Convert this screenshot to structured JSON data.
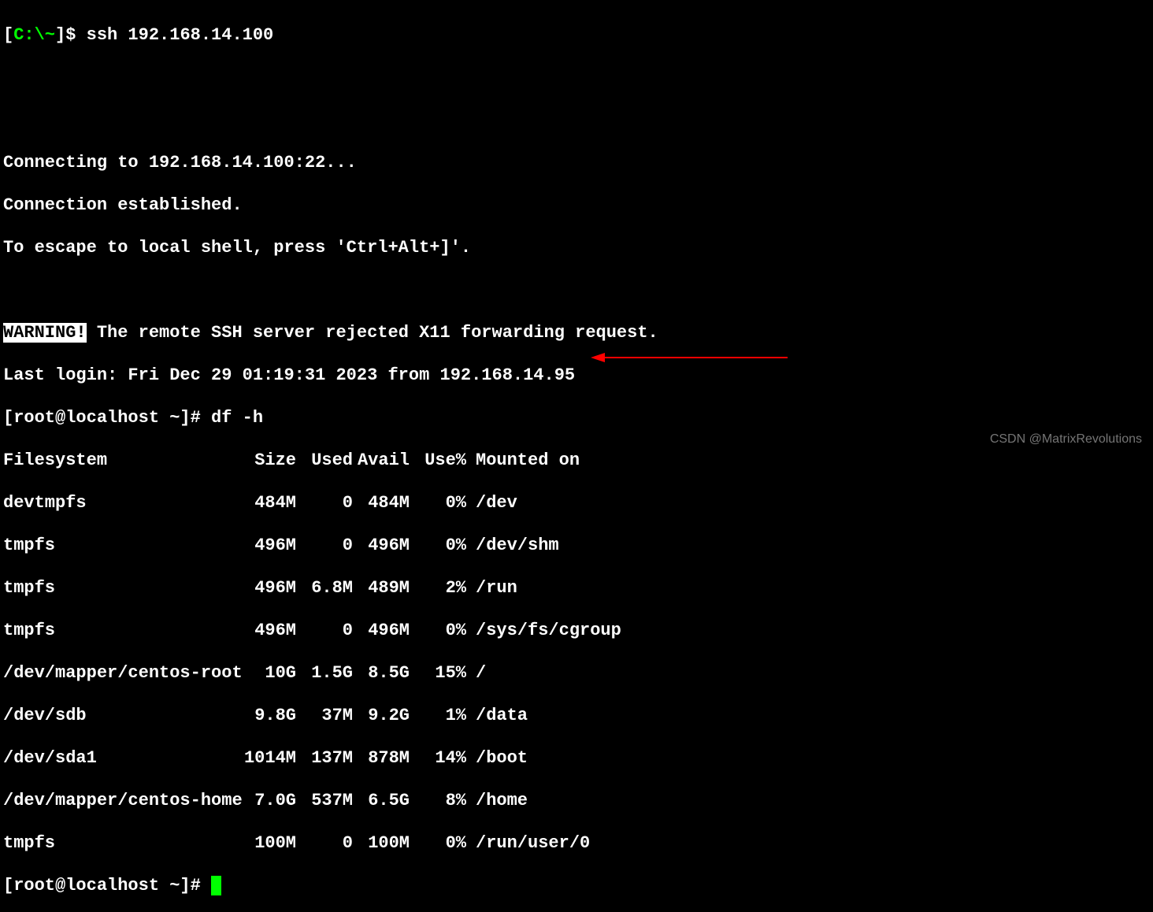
{
  "prompt1": {
    "bracket_open": "[",
    "path": "C:\\~",
    "bracket_close": "]",
    "dollar": "$",
    "command": " ssh 192.168.14.100"
  },
  "connecting_lines": {
    "line1": "Connecting to 192.168.14.100:22...",
    "line2": "Connection established.",
    "line3": "To escape to local shell, press 'Ctrl+Alt+]'."
  },
  "warning": {
    "label": "WARNING!",
    "text": " The remote SSH server rejected X11 forwarding request."
  },
  "last_login": "Last login: Fri Dec 29 01:19:31 2023 from 192.168.14.95",
  "prompt2": {
    "text": "[root@localhost ~]# ",
    "command": "df -h"
  },
  "df_header": {
    "filesystem": "Filesystem",
    "size": "Size",
    "used": "Used",
    "avail": "Avail",
    "usep": "Use%",
    "mounted": "Mounted on"
  },
  "df_rows": [
    {
      "fs": "devtmpfs",
      "size": "484M",
      "used": "0",
      "avail": "484M",
      "usep": "0%",
      "mount": "/dev"
    },
    {
      "fs": "tmpfs",
      "size": "496M",
      "used": "0",
      "avail": "496M",
      "usep": "0%",
      "mount": "/dev/shm"
    },
    {
      "fs": "tmpfs",
      "size": "496M",
      "used": "6.8M",
      "avail": "489M",
      "usep": "2%",
      "mount": "/run"
    },
    {
      "fs": "tmpfs",
      "size": "496M",
      "used": "0",
      "avail": "496M",
      "usep": "0%",
      "mount": "/sys/fs/cgroup"
    },
    {
      "fs": "/dev/mapper/centos-root",
      "size": "10G",
      "used": "1.5G",
      "avail": "8.5G",
      "usep": "15%",
      "mount": "/"
    },
    {
      "fs": "/dev/sdb",
      "size": "9.8G",
      "used": "37M",
      "avail": "9.2G",
      "usep": "1%",
      "mount": "/data"
    },
    {
      "fs": "/dev/sda1",
      "size": "1014M",
      "used": "137M",
      "avail": "878M",
      "usep": "14%",
      "mount": "/boot"
    },
    {
      "fs": "/dev/mapper/centos-home",
      "size": "7.0G",
      "used": "537M",
      "avail": "6.5G",
      "usep": "8%",
      "mount": "/home"
    },
    {
      "fs": "tmpfs",
      "size": "100M",
      "used": "0",
      "avail": "100M",
      "usep": "0%",
      "mount": "/run/user/0"
    }
  ],
  "prompt3": {
    "text": "[root@localhost ~]# "
  },
  "cursor": " ",
  "watermark": "CSDN @MatrixRevolutions"
}
